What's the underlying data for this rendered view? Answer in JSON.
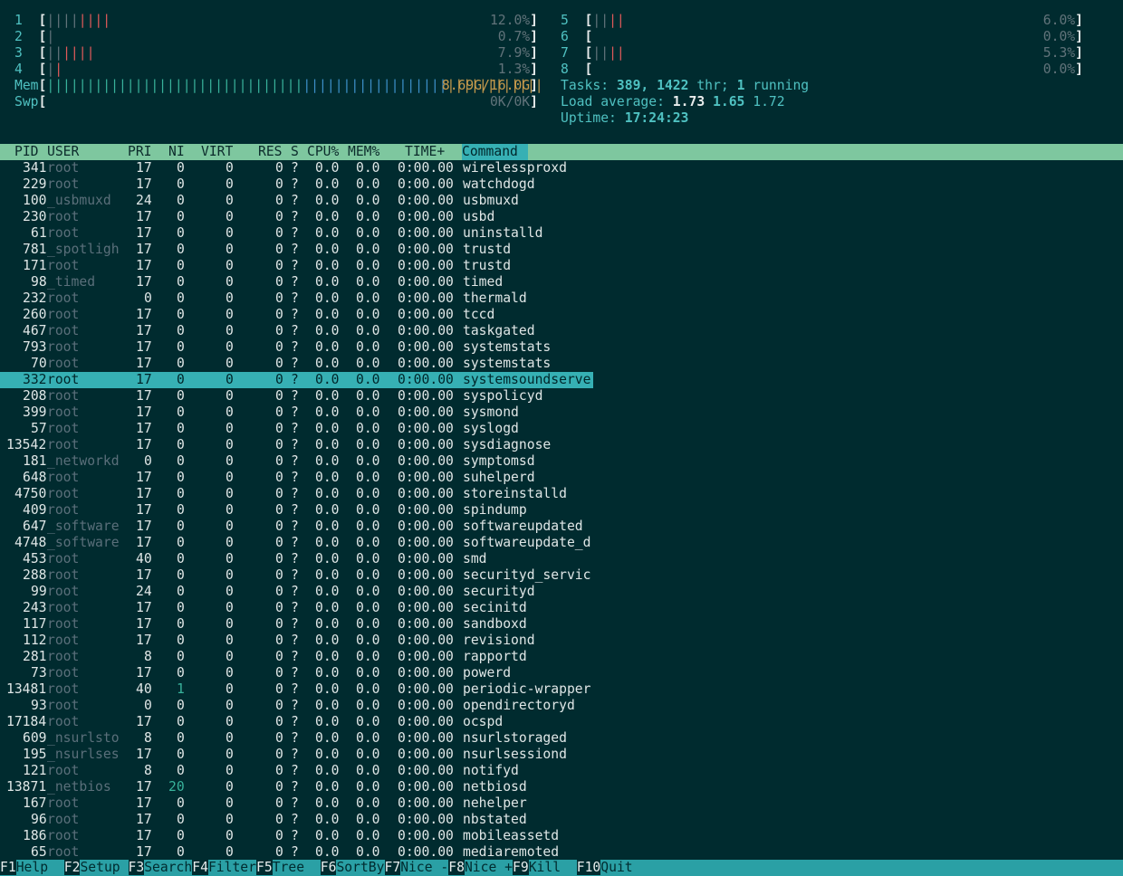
{
  "cpu_meters": [
    {
      "id": "1",
      "bar_red": "||||",
      "bar_dim": "||||",
      "value": "12.0%"
    },
    {
      "id": "2",
      "bar_red": "",
      "bar_dim": "|",
      "value": "0.7%"
    },
    {
      "id": "3",
      "bar_red": "||||",
      "bar_dim": "||",
      "value": "7.9%"
    },
    {
      "id": "4",
      "bar_red": "|",
      "bar_dim": "|",
      "value": "1.3%"
    },
    {
      "id": "5",
      "bar_red": "||",
      "bar_dim": "||",
      "value": "6.0%"
    },
    {
      "id": "6",
      "bar_red": "",
      "bar_dim": "",
      "value": "0.0%"
    },
    {
      "id": "7",
      "bar_red": "||",
      "bar_dim": "||",
      "value": "5.3%"
    },
    {
      "id": "8",
      "bar_red": "",
      "bar_dim": "",
      "value": "0.0%"
    }
  ],
  "mem": {
    "label": "Mem",
    "bar_green": "||||||||||||||||||||||||||||||||",
    "bar_blue": "||||||||||||||||||",
    "value": "8.69G/16.0G"
  },
  "swp": {
    "label": "Swp",
    "value": "0K/0K"
  },
  "tasks": {
    "label": "Tasks:",
    "count": "389,",
    "threads": "1422",
    "thr_label": "thr;",
    "running": "1",
    "running_label": "running"
  },
  "load": {
    "label": "Load average:",
    "one": "1.73",
    "five": "1.65",
    "fifteen": "1.72"
  },
  "uptime": {
    "label": "Uptime:",
    "value": "17:24:23"
  },
  "columns": {
    "pid": "PID",
    "user": "USER",
    "pri": "PRI",
    "ni": "NI",
    "virt": "VIRT",
    "res": "RES",
    "s": "S",
    "cpu": "CPU%",
    "mem": "MEM%",
    "time": "TIME+",
    "command": "Command"
  },
  "selected_pid": "332",
  "processes": [
    {
      "pid": "341",
      "user": "root",
      "pri": "17",
      "ni": "0",
      "cmd": "wirelessproxd"
    },
    {
      "pid": "229",
      "user": "root",
      "pri": "17",
      "ni": "0",
      "cmd": "watchdogd"
    },
    {
      "pid": "100",
      "user": "_usbmuxd",
      "pri": "24",
      "ni": "0",
      "cmd": "usbmuxd"
    },
    {
      "pid": "230",
      "user": "root",
      "pri": "17",
      "ni": "0",
      "cmd": "usbd"
    },
    {
      "pid": "61",
      "user": "root",
      "pri": "17",
      "ni": "0",
      "cmd": "uninstalld"
    },
    {
      "pid": "781",
      "user": "_spotligh",
      "pri": "17",
      "ni": "0",
      "cmd": "trustd"
    },
    {
      "pid": "171",
      "user": "root",
      "pri": "17",
      "ni": "0",
      "cmd": "trustd"
    },
    {
      "pid": "98",
      "user": "_timed",
      "pri": "17",
      "ni": "0",
      "cmd": "timed"
    },
    {
      "pid": "232",
      "user": "root",
      "pri": "0",
      "ni": "0",
      "cmd": "thermald"
    },
    {
      "pid": "260",
      "user": "root",
      "pri": "17",
      "ni": "0",
      "cmd": "tccd"
    },
    {
      "pid": "467",
      "user": "root",
      "pri": "17",
      "ni": "0",
      "cmd": "taskgated"
    },
    {
      "pid": "793",
      "user": "root",
      "pri": "17",
      "ni": "0",
      "cmd": "systemstats"
    },
    {
      "pid": "70",
      "user": "root",
      "pri": "17",
      "ni": "0",
      "cmd": "systemstats"
    },
    {
      "pid": "332",
      "user": "root",
      "pri": "17",
      "ni": "0",
      "cmd": "systemsoundserve"
    },
    {
      "pid": "208",
      "user": "root",
      "pri": "17",
      "ni": "0",
      "cmd": "syspolicyd"
    },
    {
      "pid": "399",
      "user": "root",
      "pri": "17",
      "ni": "0",
      "cmd": "sysmond"
    },
    {
      "pid": "57",
      "user": "root",
      "pri": "17",
      "ni": "0",
      "cmd": "syslogd"
    },
    {
      "pid": "13542",
      "user": "root",
      "pri": "17",
      "ni": "0",
      "cmd": "sysdiagnose"
    },
    {
      "pid": "181",
      "user": "_networkd",
      "pri": "0",
      "ni": "0",
      "cmd": "symptomsd"
    },
    {
      "pid": "648",
      "user": "root",
      "pri": "17",
      "ni": "0",
      "cmd": "suhelperd"
    },
    {
      "pid": "4750",
      "user": "root",
      "pri": "17",
      "ni": "0",
      "cmd": "storeinstalld"
    },
    {
      "pid": "409",
      "user": "root",
      "pri": "17",
      "ni": "0",
      "cmd": "spindump"
    },
    {
      "pid": "647",
      "user": "_software",
      "pri": "17",
      "ni": "0",
      "cmd": "softwareupdated"
    },
    {
      "pid": "4748",
      "user": "_software",
      "pri": "17",
      "ni": "0",
      "cmd": "softwareupdate_d"
    },
    {
      "pid": "453",
      "user": "root",
      "pri": "40",
      "ni": "0",
      "cmd": "smd"
    },
    {
      "pid": "288",
      "user": "root",
      "pri": "17",
      "ni": "0",
      "cmd": "securityd_servic"
    },
    {
      "pid": "99",
      "user": "root",
      "pri": "24",
      "ni": "0",
      "cmd": "securityd"
    },
    {
      "pid": "243",
      "user": "root",
      "pri": "17",
      "ni": "0",
      "cmd": "secinitd"
    },
    {
      "pid": "117",
      "user": "root",
      "pri": "17",
      "ni": "0",
      "cmd": "sandboxd"
    },
    {
      "pid": "112",
      "user": "root",
      "pri": "17",
      "ni": "0",
      "cmd": "revisiond"
    },
    {
      "pid": "281",
      "user": "root",
      "pri": "8",
      "ni": "0",
      "cmd": "rapportd"
    },
    {
      "pid": "73",
      "user": "root",
      "pri": "17",
      "ni": "0",
      "cmd": "powerd"
    },
    {
      "pid": "13481",
      "user": "root",
      "pri": "40",
      "ni": "1",
      "cmd": "periodic-wrapper"
    },
    {
      "pid": "93",
      "user": "root",
      "pri": "0",
      "ni": "0",
      "cmd": "opendirectoryd"
    },
    {
      "pid": "17184",
      "user": "root",
      "pri": "17",
      "ni": "0",
      "cmd": "ocspd"
    },
    {
      "pid": "609",
      "user": "_nsurlsto",
      "pri": "8",
      "ni": "0",
      "cmd": "nsurlstoraged"
    },
    {
      "pid": "195",
      "user": "_nsurlses",
      "pri": "17",
      "ni": "0",
      "cmd": "nsurlsessiond"
    },
    {
      "pid": "121",
      "user": "root",
      "pri": "8",
      "ni": "0",
      "cmd": "notifyd"
    },
    {
      "pid": "13871",
      "user": "_netbios",
      "pri": "17",
      "ni": "20",
      "cmd": "netbiosd"
    },
    {
      "pid": "167",
      "user": "root",
      "pri": "17",
      "ni": "0",
      "cmd": "nehelper"
    },
    {
      "pid": "96",
      "user": "root",
      "pri": "17",
      "ni": "0",
      "cmd": "nbstated"
    },
    {
      "pid": "186",
      "user": "root",
      "pri": "17",
      "ni": "0",
      "cmd": "mobileassetd"
    },
    {
      "pid": "65",
      "user": "root",
      "pri": "17",
      "ni": "0",
      "cmd": "mediaremoted"
    }
  ],
  "row_defaults": {
    "virt": "0",
    "res": "0",
    "s": "?",
    "cpu": "0.0",
    "mem": "0.0",
    "time": "0:00.00"
  },
  "footer": [
    {
      "key": "F1",
      "label": "Help  "
    },
    {
      "key": "F2",
      "label": "Setup "
    },
    {
      "key": "F3",
      "label": "Search"
    },
    {
      "key": "F4",
      "label": "Filter"
    },
    {
      "key": "F5",
      "label": "Tree  "
    },
    {
      "key": "F6",
      "label": "SortBy"
    },
    {
      "key": "F7",
      "label": "Nice -"
    },
    {
      "key": "F8",
      "label": "Nice +"
    },
    {
      "key": "F9",
      "label": "Kill  "
    },
    {
      "key": "F10",
      "label": "Quit  "
    }
  ]
}
